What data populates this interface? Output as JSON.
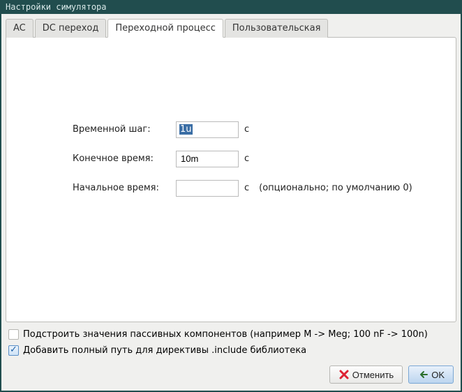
{
  "window": {
    "title": "Настройки симулятора"
  },
  "tabs": {
    "ac": "AC",
    "dc": "DC переход",
    "transient": "Переходной процесс",
    "custom": "Пользовательская"
  },
  "form": {
    "time_step": {
      "label": "Временной шаг:",
      "value": "1u",
      "unit": "с"
    },
    "final_time": {
      "label": "Конечное время:",
      "value": "10m",
      "unit": "с"
    },
    "initial_time": {
      "label": "Начальное время:",
      "value": "",
      "unit": "с",
      "hint": "(опционально; по умолчанию 0)"
    }
  },
  "checks": {
    "adjust": {
      "label": "Подстроить значения пассивных компонентов (например M -> Meg; 100 nF -> 100n)",
      "checked": false
    },
    "fullpath": {
      "label": "Добавить полный путь для директивы .include библиотека",
      "checked": true
    }
  },
  "buttons": {
    "cancel": "Отменить",
    "ok": "OK"
  }
}
